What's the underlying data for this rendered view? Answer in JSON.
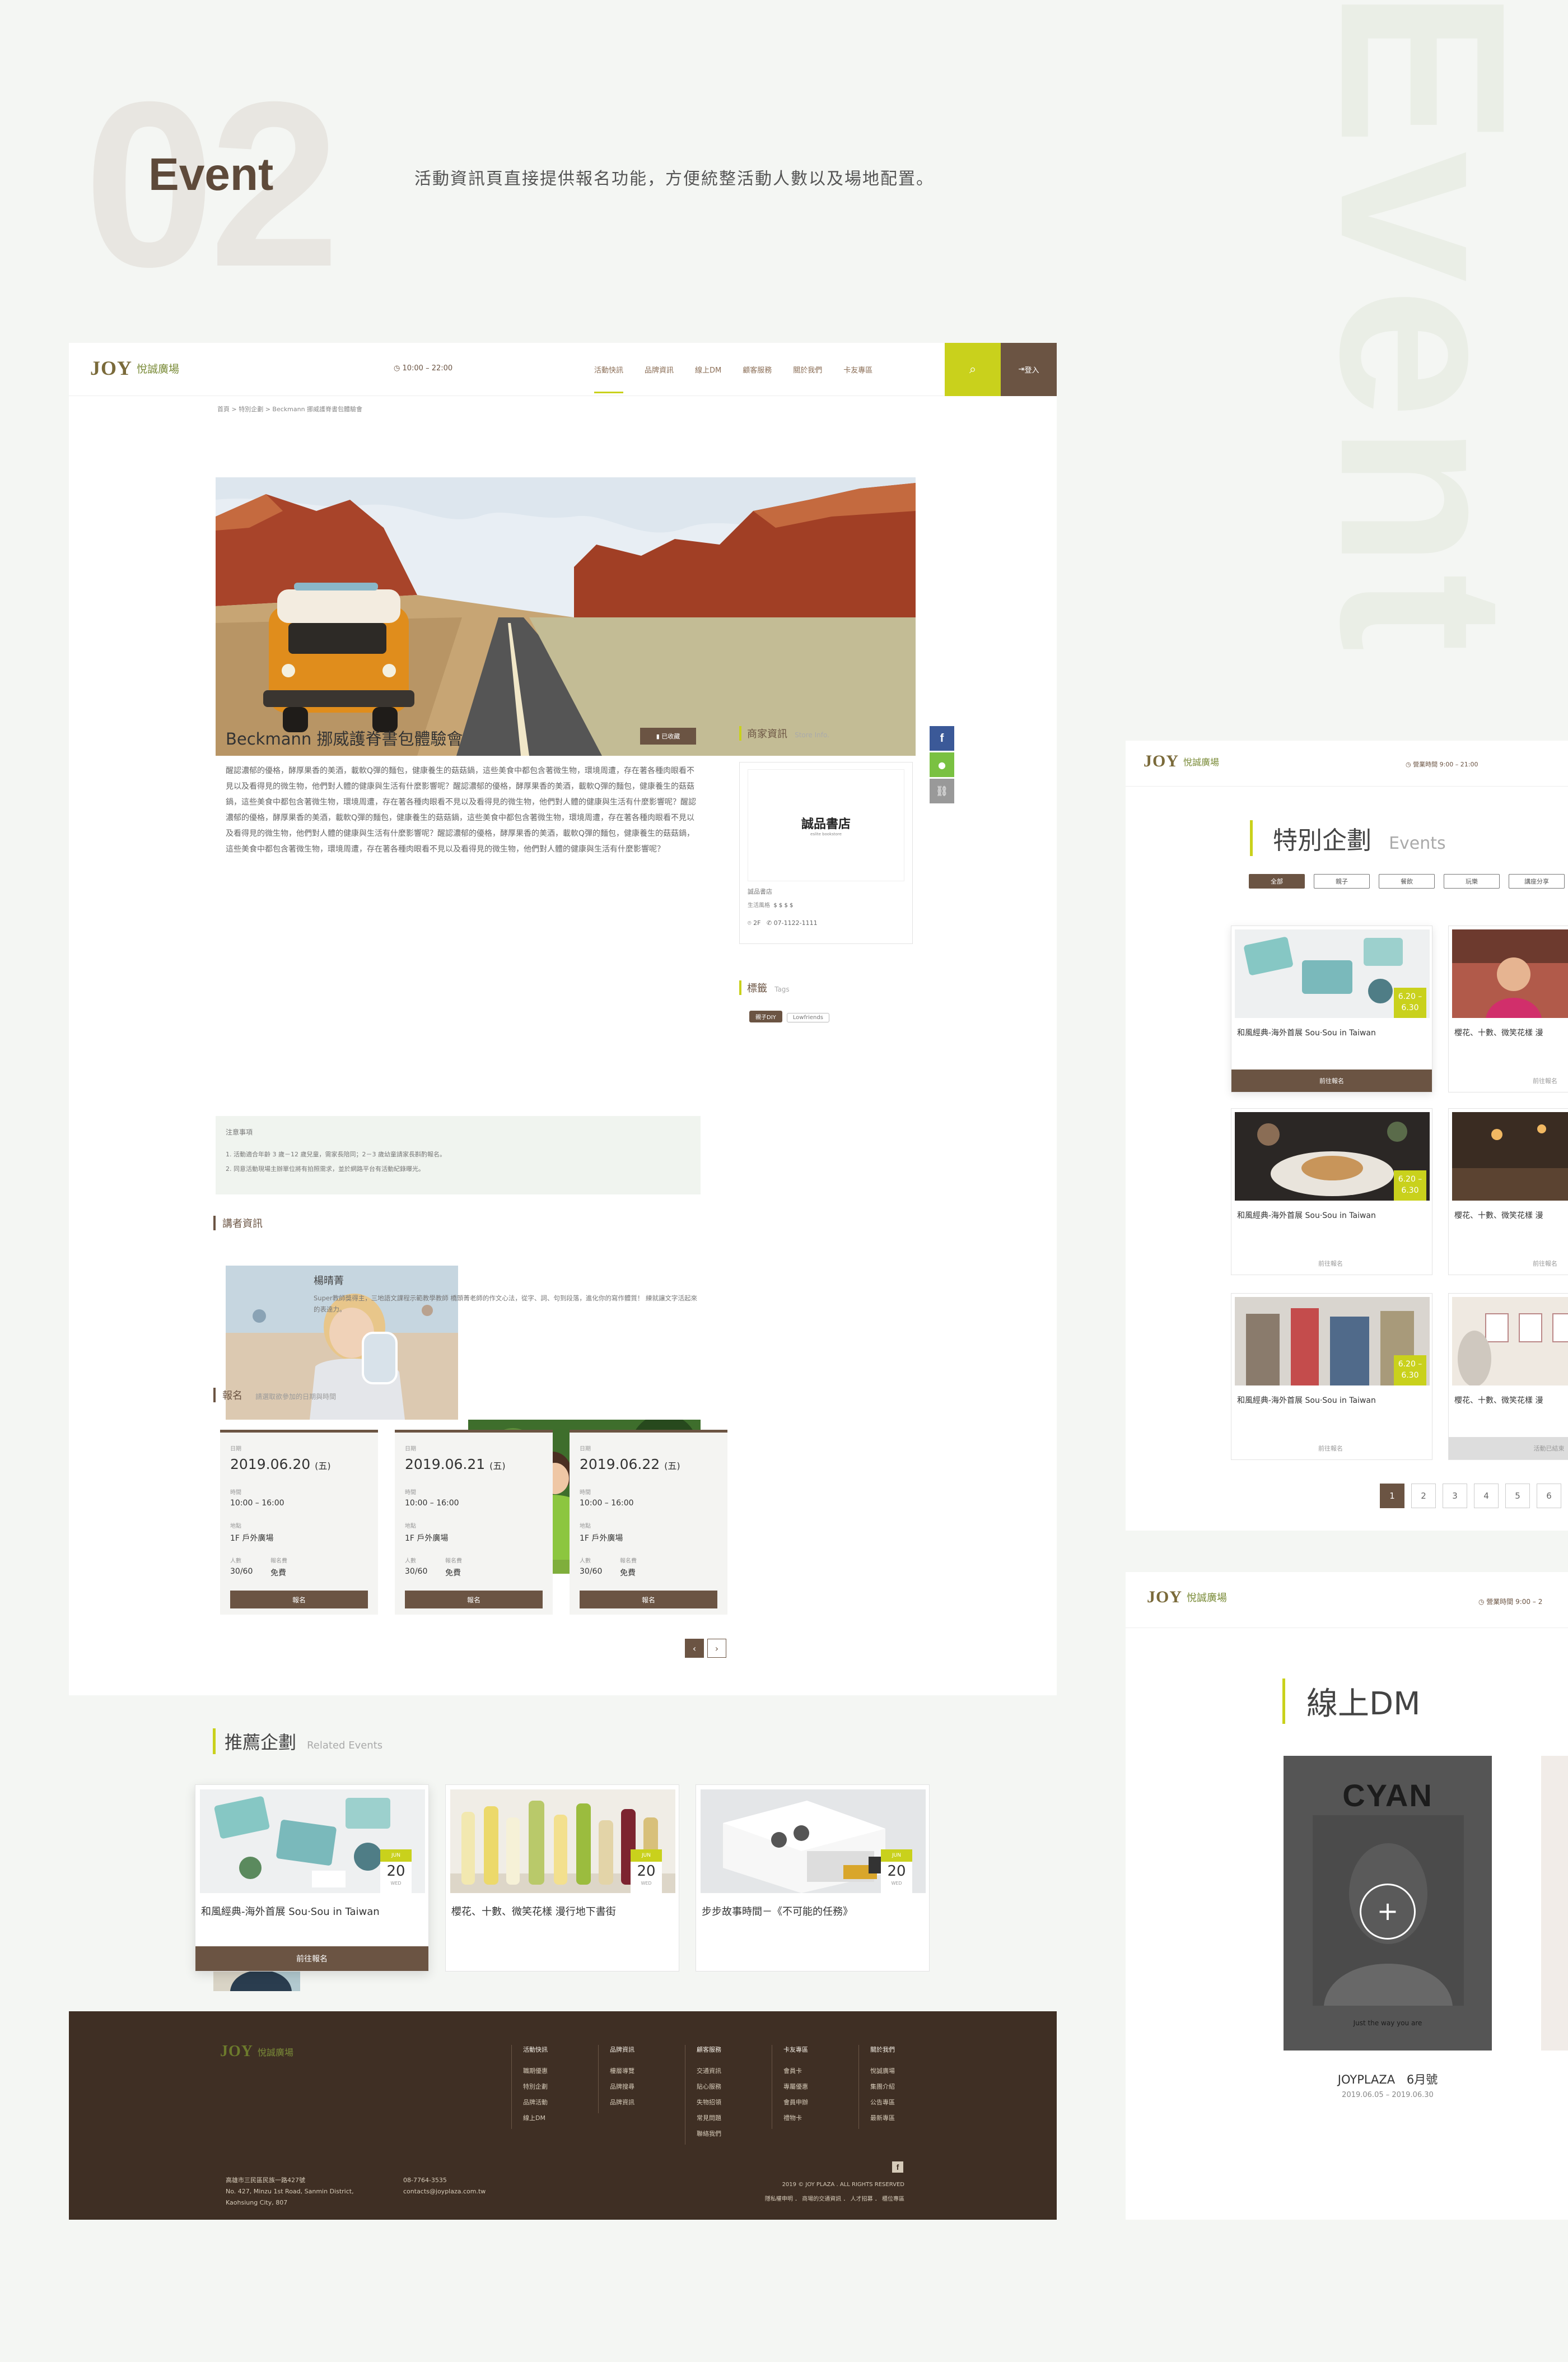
{
  "section": {
    "number": "02",
    "title": "Event",
    "desc": "活動資訊頁直接提供報名功能，方便統整活動人數以及場地配置。",
    "bg_word": "Event"
  },
  "main": {
    "logo": {
      "joy": "JOY",
      "plaza": "PLAZA",
      "name": "悅誠廣場"
    },
    "hours": "10:00 – 22:00",
    "nav": [
      "活動快訊",
      "品牌資訊",
      "線上DM",
      "顧客服務",
      "關於我們",
      "卡友專區"
    ],
    "login": "登入",
    "breadcrumb": "首頁 > 特別企劃 > Beckmann 挪威護脊書包體驗會",
    "title": "Beckmann 挪威護脊書包體驗會",
    "saved": "已收藏",
    "body": "醒認濃郁的優格，酵厚果香的美酒，載軟Q彈的麵包，健康養生的菇菇鍋，這些美食中都包含著微生物，環境周遭，存在著各種肉眼看不見以及看得見的微生物，他們對人體的健康與生活有什麼影響呢？醒認濃郁的優格，酵厚果香的美酒，載軟Q彈的麵包，健康養生的菇菇鍋，這些美食中都包含著微生物，環境周遭，存在著各種肉眼看不見以及看得見的微生物，他們對人體的健康與生活有什麼影響呢？醒認濃郁的優格，酵厚果香的美酒，載軟Q彈的麵包，健康養生的菇菇鍋，這些美食中都包含著微生物，環境周遭，存在著各種肉眼看不見以及看得見的微生物，他們對人體的健康與生活有什麼影響呢？醒認濃郁的優格，酵厚果香的美酒，載軟Q彈的麵包，健康養生的菇菇鍋，這些美食中都包含著微生物，環境周遭，存在著各種肉眼看不見以及看得見的微生物，他們對人體的健康與生活有什麼影響呢？",
    "notes_title": "注意事項",
    "notes": [
      "1. 活動適合年齡 3 歲－12 歲兒童，需家長陪同；2－3 歲幼童請家長斟酌報名。",
      "2. 同意活動現場主辦單位將有拍照需求，並於網路平台有活動紀錄曝光。"
    ],
    "speaker_heading": "講者資訊",
    "speaker_name": "楊晴菁",
    "speaker_bio": "Super教師獎得主，三地語文課程示範教學教師 橋頭菁老師的作文心法，從字、詞、句到段落，進化你的寫作體質！ 練就讓文字活起來的表達力。",
    "reg_heading": "報名",
    "reg_sub": "請選取欲參加的日期與時間",
    "sessions": [
      {
        "date_label": "日期",
        "date": "2019.06.20",
        "dow": "(五)",
        "time_label": "時間",
        "time": "10:00 – 16:00",
        "place_label": "地點",
        "place": "1F 戶外廣場",
        "count_label": "人數",
        "count": "30/60",
        "fee_label": "報名費",
        "fee": "免費",
        "btn": "報名"
      },
      {
        "date_label": "日期",
        "date": "2019.06.21",
        "dow": "(五)",
        "time_label": "時間",
        "time": "10:00 – 16:00",
        "place_label": "地點",
        "place": "1F 戶外廣場",
        "count_label": "人數",
        "count": "30/60",
        "fee_label": "報名費",
        "fee": "免費",
        "btn": "報名"
      },
      {
        "date_label": "日期",
        "date": "2019.06.22",
        "dow": "(五)",
        "time_label": "時間",
        "time": "10:00 – 16:00",
        "place_label": "地點",
        "place": "1F 戶外廣場",
        "count_label": "人數",
        "count": "30/60",
        "fee_label": "報名費",
        "fee": "免費",
        "btn": "報名"
      }
    ],
    "store_heading": "商家資訊",
    "store_heading_en": "Store Info.",
    "store_logo": "誠品書店",
    "store_logo_en": "eslite bookstore",
    "store_name": "誠品書店",
    "store_price_label": "生活風格",
    "store_price": "$ $ $ $",
    "store_floor": "2F",
    "store_phone": "07-1122-1111",
    "tags_heading": "標籤",
    "tags_heading_en": "Tags",
    "tags": [
      "親子DIY",
      "Lowfriends"
    ]
  },
  "related": {
    "heading": "推薦企劃",
    "heading_en": "Related Events",
    "items": [
      {
        "title": "和風經典-海外首展 Sou·Sou in Taiwan",
        "badge_top": "JUN",
        "day": "20",
        "dow": "WED",
        "btn": "前往報名"
      },
      {
        "title": "櫻花、十數、微笑花樣 漫行地下書街",
        "badge_top": "JUN",
        "day": "20",
        "dow": "WED"
      },
      {
        "title": "步步故事時間－《不可能的任務》",
        "badge_top": "JUN",
        "day": "20",
        "dow": "WED"
      }
    ]
  },
  "footer": {
    "logo_name": "悅誠廣場",
    "cols": [
      {
        "h": "活動快訊",
        "items": [
          "職期優惠",
          "特別企劃",
          "品牌活動",
          "線上DM"
        ]
      },
      {
        "h": "品牌資訊",
        "items": [
          "樓層導覽",
          "品牌搜尋",
          "品牌資訊"
        ]
      },
      {
        "h": "顧客服務",
        "items": [
          "交通資訊",
          "貼心服務",
          "失物招領",
          "常見問題",
          "聯絡我們"
        ]
      },
      {
        "h": "卡友專區",
        "items": [
          "會員卡",
          "專屬優惠",
          "會員申辦",
          "禮物卡"
        ]
      },
      {
        "h": "關於我們",
        "items": [
          "悅誠廣場",
          "集團介紹",
          "公告專區",
          "最新專區"
        ]
      }
    ],
    "address": "高雄市三民區民族一路427號",
    "address_en1": "No. 427, Minzu 1st Road, Sanmin District,",
    "address_en2": "Kaohsiung City, 807",
    "phone": "08-7764-3535",
    "email": "contacts@joyplaza.com.tw",
    "copyright": "2019 © JOY PLAZA . ALL RIGHTS RESERVED",
    "links": "隱私權申明 ． 商場的交通資訊 ． 人才招募 ． 櫃位專區"
  },
  "events_page": {
    "hours": "營業時間 9:00 – 21:00",
    "heading": "特別企劃",
    "heading_en": "Events",
    "filters": [
      "全部",
      "親子",
      "餐飲",
      "玩樂",
      "講座分享"
    ],
    "cards": [
      {
        "title": "和風經典-海外首展 Sou·Sou in Taiwan",
        "badge": "6.20 – 6.30",
        "btn": "前往報名"
      },
      {
        "title": "櫻花、十數、微笑花樣 漫",
        "btn": "前往報名"
      },
      {
        "title": "和風經典-海外首展 Sou·Sou in Taiwan",
        "badge": "6.20 – 6.30",
        "btn": "前往報名"
      },
      {
        "title": "櫻花、十數、微笑花樣 漫",
        "btn": "前往報名"
      },
      {
        "title": "和風經典-海外首展 Sou·Sou in Taiwan",
        "badge": "6.20 – 6.30",
        "btn": "前往報名"
      },
      {
        "title": "櫻花、十數、微笑花樣 漫",
        "btn": "活動已結束"
      }
    ],
    "pages": [
      "1",
      "2",
      "3",
      "4",
      "5",
      "6"
    ]
  },
  "dm_page": {
    "hours": "營業時間 9:00 – 2",
    "heading": "線上DM",
    "cover_title": "CYAN",
    "cover_tag": "Just the way you are",
    "name": "JOYPLAZA 6月號",
    "range": "2019.06.05 – 2019.06.30"
  },
  "colors": {
    "accent": "#c9d11c",
    "brown": "#6b5443",
    "footer": "#3f2f24",
    "page_bg": "#f4f6f3"
  }
}
